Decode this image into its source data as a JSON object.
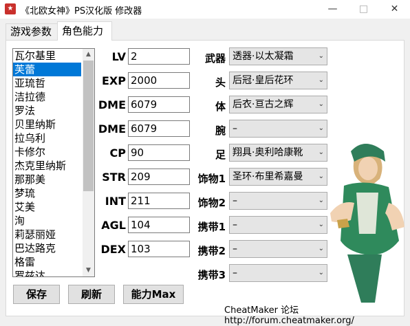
{
  "window": {
    "title": "《北欧女神》PS汉化版 修改器",
    "minimize": "—",
    "maximize": "□",
    "close": "✕"
  },
  "tabs": [
    {
      "label": "游戏参数"
    },
    {
      "label": "角色能力"
    }
  ],
  "characters": {
    "items": [
      "瓦尔基里",
      "芙蕾",
      "亚琉哲",
      "洁拉德",
      "罗法",
      "贝里纳斯",
      "拉乌利",
      "卡修尔",
      "杰克里纳斯",
      "那那美",
      "梦琉",
      "艾美",
      "洵",
      "莉瑟丽娅",
      "巴达路克",
      "格雷",
      "罗兹达"
    ],
    "selected": "芙蕾"
  },
  "stats": {
    "lv": {
      "label": "LV",
      "value": "2"
    },
    "exp": {
      "label": "EXP",
      "value": "2000"
    },
    "dme1": {
      "label": "DME",
      "value": "6079"
    },
    "dme2": {
      "label": "DME",
      "value": "6079"
    },
    "cp": {
      "label": "CP",
      "value": "90"
    },
    "str": {
      "label": "STR",
      "value": "209"
    },
    "int": {
      "label": "INT",
      "value": "211"
    },
    "agl": {
      "label": "AGL",
      "value": "104"
    },
    "dex": {
      "label": "DEX",
      "value": "103"
    }
  },
  "equipment": {
    "weapon": {
      "label": "武器",
      "value": "透器·以太凝霜"
    },
    "head": {
      "label": "头",
      "value": "后冠·皇后花环"
    },
    "body": {
      "label": "体",
      "value": "后衣·亘古之辉"
    },
    "arm": {
      "label": "腕",
      "value": "–"
    },
    "foot": {
      "label": "足",
      "value": "翔具·奥利哈康靴"
    },
    "accessory1": {
      "label": "饰物1",
      "value": "圣环·布里希嘉曼"
    },
    "accessory2": {
      "label": "饰物2",
      "value": "–"
    },
    "carry1": {
      "label": "携带1",
      "value": "–"
    },
    "carry2": {
      "label": "携带2",
      "value": "–"
    },
    "carry3": {
      "label": "携带3",
      "value": "–"
    }
  },
  "buttons": {
    "save": "保存",
    "refresh": "刷新",
    "max": "能力Max"
  },
  "footer": "CheatMaker 论坛 http://forum.cheatmaker.org/"
}
